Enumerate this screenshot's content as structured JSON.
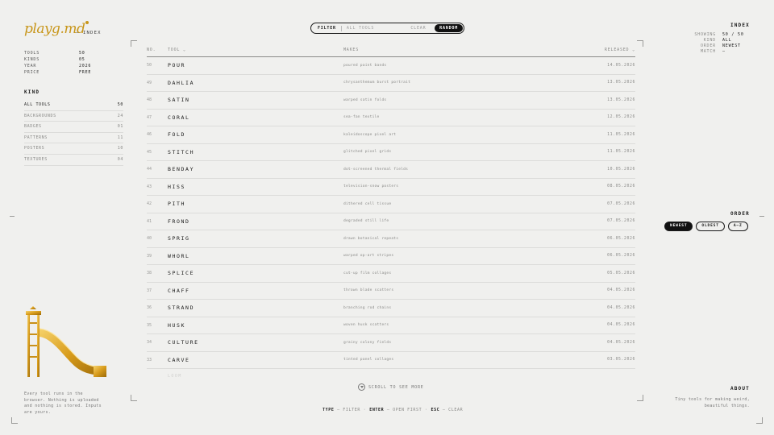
{
  "brand": {
    "logo": "playg.md",
    "section": "INDEX",
    "accent": "#c8961a"
  },
  "meta": [
    {
      "key": "TOOLS",
      "value": "50"
    },
    {
      "key": "KINDS",
      "value": "05"
    },
    {
      "key": "YEAR",
      "value": "2026"
    },
    {
      "key": "PRICE",
      "value": "FREE"
    }
  ],
  "kind": {
    "title": "KIND",
    "items": [
      {
        "label": "ALL TOOLS",
        "count": "50"
      },
      {
        "label": "BACKGROUNDS",
        "count": "24"
      },
      {
        "label": "BADGES",
        "count": "01"
      },
      {
        "label": "PATTERNS",
        "count": "11"
      },
      {
        "label": "POSTERS",
        "count": "10"
      },
      {
        "label": "TEXTURES",
        "count": "04"
      }
    ]
  },
  "about_left": "Every tool runs in the browser. Nothing is uploaded and nothing is stored. Inputs are yours.",
  "filter": {
    "label": "FILTER",
    "placeholder": "ALL TOOLS",
    "clear": "CLEAR",
    "random": "RANDOM"
  },
  "table": {
    "headers": {
      "no": "NO.",
      "tool": "TOOL ⌄",
      "makes": "MAKES",
      "released": "RELEASED ⌄"
    },
    "rows": [
      {
        "no": "50",
        "tool": "POUR",
        "makes": "poured paint bands",
        "released": "14.05.2026"
      },
      {
        "no": "49",
        "tool": "DAHLIA",
        "makes": "chrysanthemum burst portrait",
        "released": "13.05.2026"
      },
      {
        "no": "48",
        "tool": "SATIN",
        "makes": "warped satin folds",
        "released": "13.05.2026"
      },
      {
        "no": "47",
        "tool": "CORAL",
        "makes": "sea-fan textile",
        "released": "12.05.2026"
      },
      {
        "no": "46",
        "tool": "FOLD",
        "makes": "kaleidoscope pixel art",
        "released": "11.05.2026"
      },
      {
        "no": "45",
        "tool": "STITCH",
        "makes": "glitched pixel grids",
        "released": "11.05.2026"
      },
      {
        "no": "44",
        "tool": "BENDAY",
        "makes": "dot-screened thermal fields",
        "released": "10.05.2026"
      },
      {
        "no": "43",
        "tool": "HISS",
        "makes": "television-snow posters",
        "released": "08.05.2026"
      },
      {
        "no": "42",
        "tool": "PITH",
        "makes": "dithered cell tissue",
        "released": "07.05.2026"
      },
      {
        "no": "41",
        "tool": "FROND",
        "makes": "degraded still life",
        "released": "07.05.2026"
      },
      {
        "no": "40",
        "tool": "SPRIG",
        "makes": "drawn botanical repeats",
        "released": "06.05.2026"
      },
      {
        "no": "39",
        "tool": "WHORL",
        "makes": "warped op-art stripes",
        "released": "06.05.2026"
      },
      {
        "no": "38",
        "tool": "SPLICE",
        "makes": "cut-up film collages",
        "released": "05.05.2026"
      },
      {
        "no": "37",
        "tool": "CHAFF",
        "makes": "thrown blade scatters",
        "released": "04.05.2026"
      },
      {
        "no": "36",
        "tool": "STRAND",
        "makes": "branching rod chains",
        "released": "04.05.2026"
      },
      {
        "no": "35",
        "tool": "HUSK",
        "makes": "woven husk scatters",
        "released": "04.05.2026"
      },
      {
        "no": "34",
        "tool": "CULTURE",
        "makes": "grainy colony fields",
        "released": "04.05.2026"
      },
      {
        "no": "33",
        "tool": "CARVE",
        "makes": "tinted panel collages",
        "released": "03.05.2026"
      }
    ],
    "fade_row": "LOOM"
  },
  "scroll_hint": "SCROLL TO SEE MORE",
  "shortcuts": [
    {
      "key": "TYPE",
      "action": "FILTER"
    },
    {
      "key": "ENTER",
      "action": "OPEN FIRST"
    },
    {
      "key": "ESC",
      "action": "CLEAR"
    }
  ],
  "index": {
    "title": "INDEX",
    "rows": [
      {
        "key": "SHOWING",
        "value": "50 / 50"
      },
      {
        "key": "KIND",
        "value": "ALL"
      },
      {
        "key": "ORDER",
        "value": "NEWEST"
      },
      {
        "key": "MATCH",
        "value": "—"
      }
    ]
  },
  "order": {
    "title": "ORDER",
    "options": [
      "NEWEST",
      "OLDEST",
      "A–Z"
    ],
    "selected": "NEWEST"
  },
  "about": {
    "title": "ABOUT",
    "text": "Tiny tools for making weird, beautiful things."
  }
}
